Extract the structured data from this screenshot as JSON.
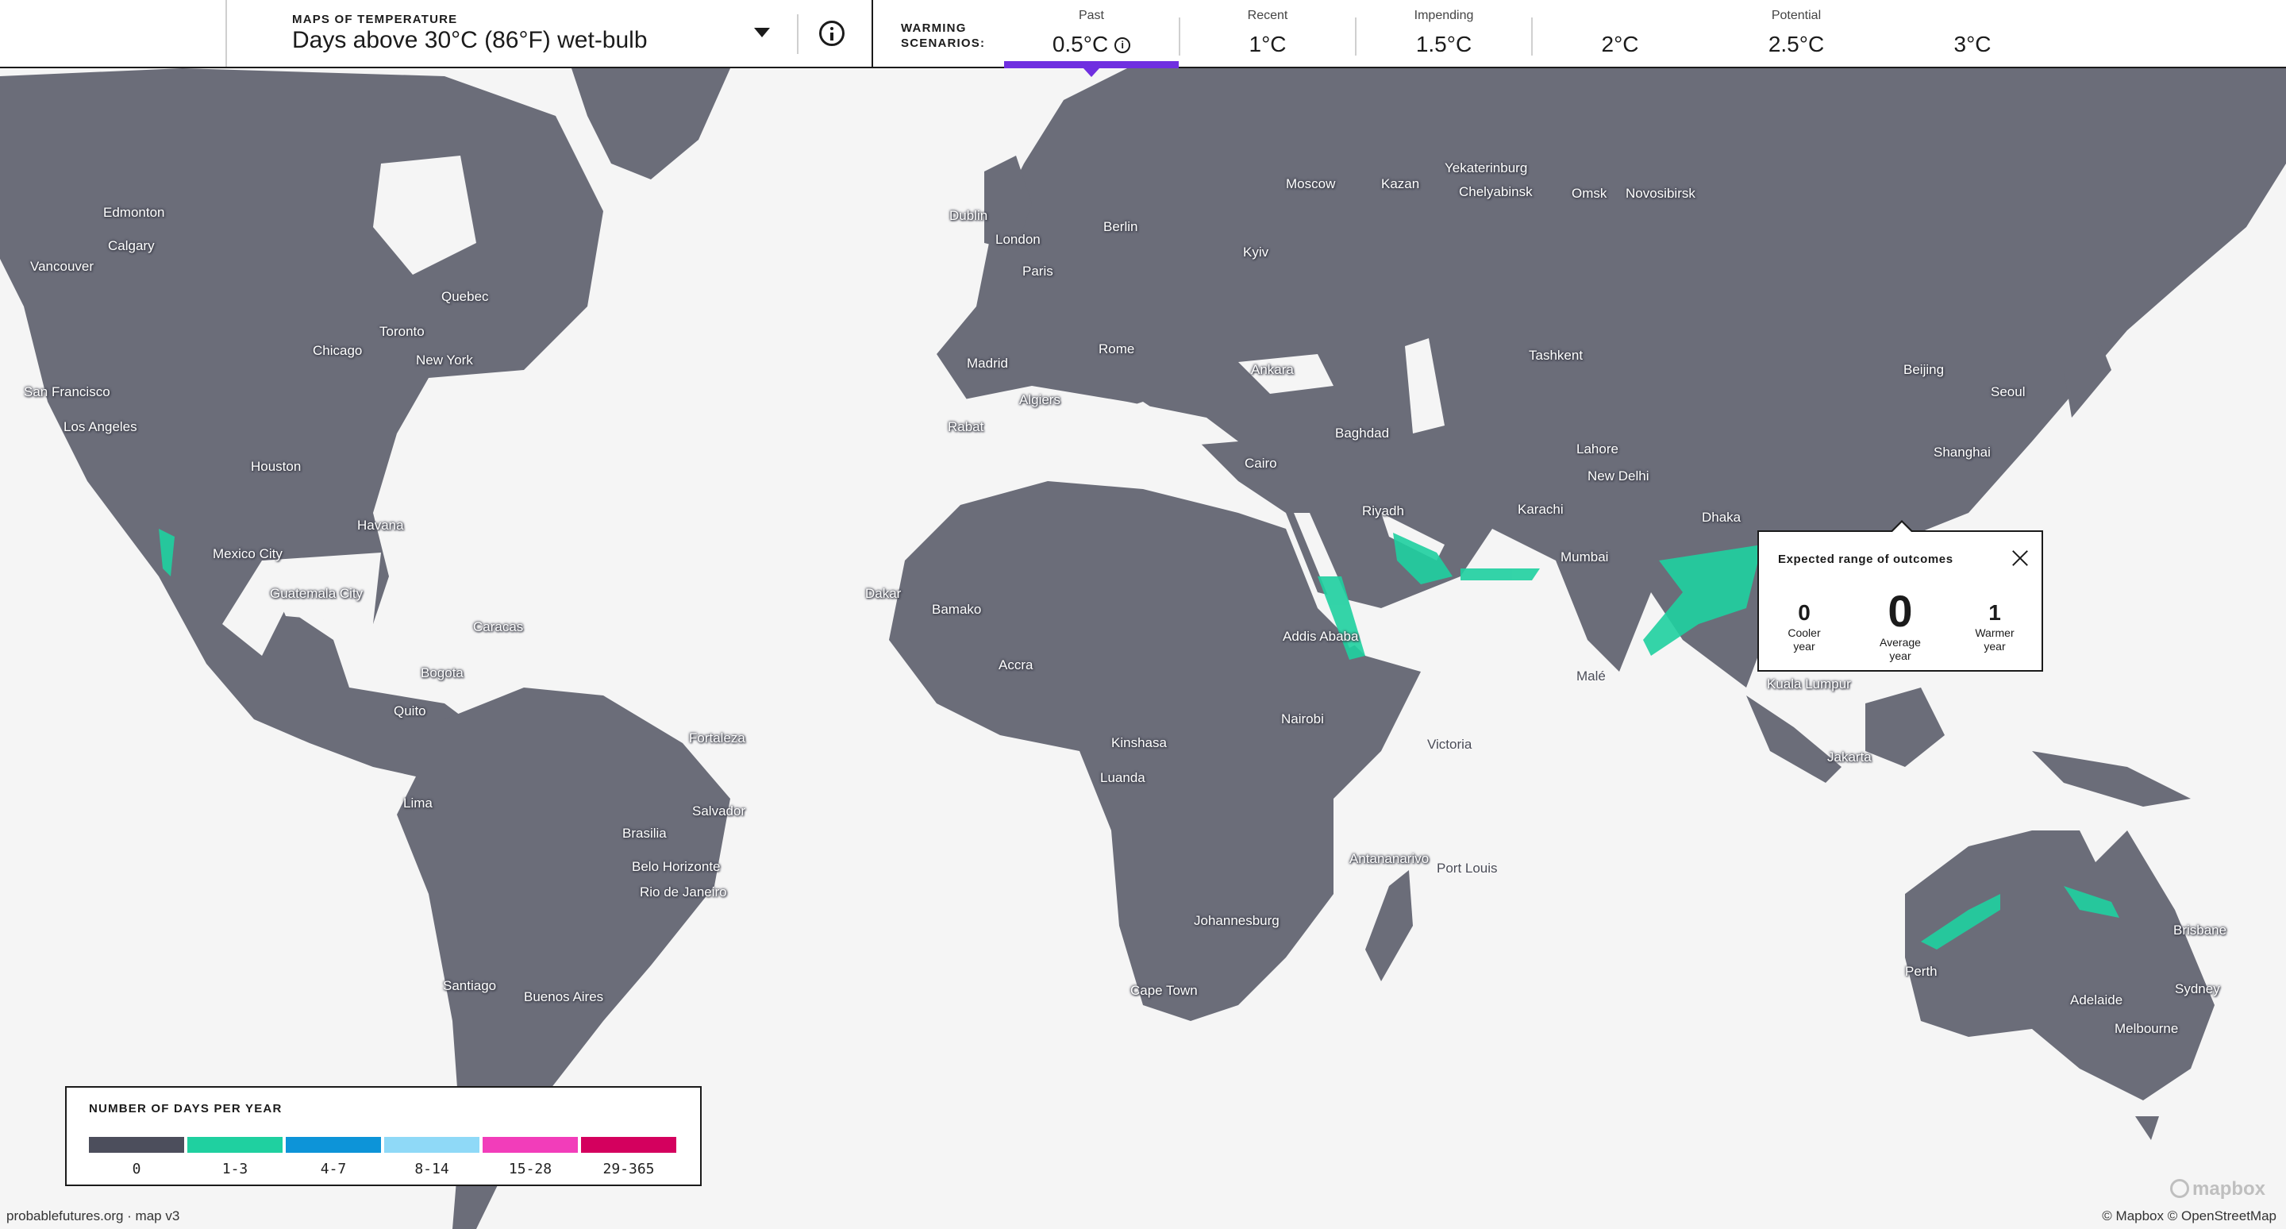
{
  "header": {
    "map_eyebrow": "MAPS OF TEMPERATURE",
    "map_title": "Days above 30°C (86°F) wet-bulb",
    "warming_label_line1": "WARMING",
    "warming_label_line2": "SCENARIOS:",
    "scenarios": [
      {
        "category": "Past",
        "value": "0.5°C",
        "active": true
      },
      {
        "category": "Recent",
        "value": "1°C",
        "active": false
      },
      {
        "category": "Impending",
        "value": "1.5°C",
        "active": false
      },
      {
        "category": "",
        "value": "2°C",
        "active": false
      },
      {
        "category": "Potential",
        "value": "2.5°C",
        "active": false
      },
      {
        "category": "",
        "value": "3°C",
        "active": false
      }
    ],
    "active_info_glyph": "i"
  },
  "cities": {
    "edmonton": "Edmonton",
    "calgary": "Calgary",
    "vancouver": "Vancouver",
    "quebec": "Quebec",
    "toronto": "Toronto",
    "chicago": "Chicago",
    "new_york": "New York",
    "san_francisco": "San Francisco",
    "los_angeles": "Los Angeles",
    "houston": "Houston",
    "havana": "Havana",
    "mexico_city": "Mexico City",
    "guatemala_city": "Guatemala City",
    "caracas": "Caracas",
    "bogota": "Bogota",
    "quito": "Quito",
    "lima": "Lima",
    "fortaleza": "Fortaleza",
    "salvador": "Salvador",
    "brasilia": "Brasilia",
    "belo_horizonte": "Belo Horizonte",
    "rio": "Rio de Janeiro",
    "santiago": "Santiago",
    "buenos_aires": "Buenos Aires",
    "dublin": "Dublin",
    "london": "London",
    "paris": "Paris",
    "berlin": "Berlin",
    "madrid": "Madrid",
    "rome": "Rome",
    "algiers": "Algiers",
    "rabat": "Rabat",
    "moscow": "Moscow",
    "kazan": "Kazan",
    "yekaterinburg": "Yekaterinburg",
    "chelyabinsk": "Chelyabinsk",
    "omsk": "Omsk",
    "novosibirsk": "Novosibirsk",
    "kyiv": "Kyiv",
    "ankara": "Ankara",
    "tashkent": "Tashkent",
    "baghdad": "Baghdad",
    "cairo": "Cairo",
    "riyadh": "Riyadh",
    "karachi": "Karachi",
    "lahore": "Lahore",
    "new_delhi": "New Delhi",
    "mumbai": "Mumbai",
    "dhaka": "Dhaka",
    "beijing": "Beijing",
    "seoul": "Seoul",
    "shanghai": "Shanghai",
    "dakar": "Dakar",
    "bamako": "Bamako",
    "accra": "Accra",
    "addis_ababa": "Addis Ababa",
    "nairobi": "Nairobi",
    "kinshasa": "Kinshasa",
    "luanda": "Luanda",
    "victoria": "Victoria",
    "male": "Malé",
    "antananarivo": "Antananarivo",
    "port_louis": "Port Louis",
    "johannesburg": "Johannesburg",
    "cape_town": "Cape Town",
    "kuala_lumpur": "Kuala Lumpur",
    "jakarta": "Jakarta",
    "brisbane": "Brisbane",
    "perth": "Perth",
    "sydney": "Sydney",
    "adelaide": "Adelaide",
    "melbourne": "Melbourne"
  },
  "legend": {
    "title": "NUMBER OF DAYS PER YEAR",
    "bins": [
      {
        "label": "0",
        "color": "#4c4e5c"
      },
      {
        "label": "1-3",
        "color": "#1fd0a0"
      },
      {
        "label": "4-7",
        "color": "#0d94d8"
      },
      {
        "label": "8-14",
        "color": "#8fd9f7"
      },
      {
        "label": "15-28",
        "color": "#f23dba"
      },
      {
        "label": "29-365",
        "color": "#d4005e"
      }
    ]
  },
  "popup": {
    "title": "Expected range of outcomes",
    "cooler_value": "0",
    "cooler_label_1": "Cooler",
    "cooler_label_2": "year",
    "average_value": "0",
    "average_label_1": "Average",
    "average_label_2": "year",
    "warmer_value": "1",
    "warmer_label_1": "Warmer",
    "warmer_label_2": "year"
  },
  "footer": {
    "left": "probablefutures.org · map v3",
    "right": "© Mapbox © OpenStreetMap",
    "logo": "mapbox"
  },
  "colors": {
    "land": "#6b6d79",
    "ocean": "#f5f5f5",
    "accent": "#6f2fe0",
    "low_band": "#1fd0a0"
  }
}
